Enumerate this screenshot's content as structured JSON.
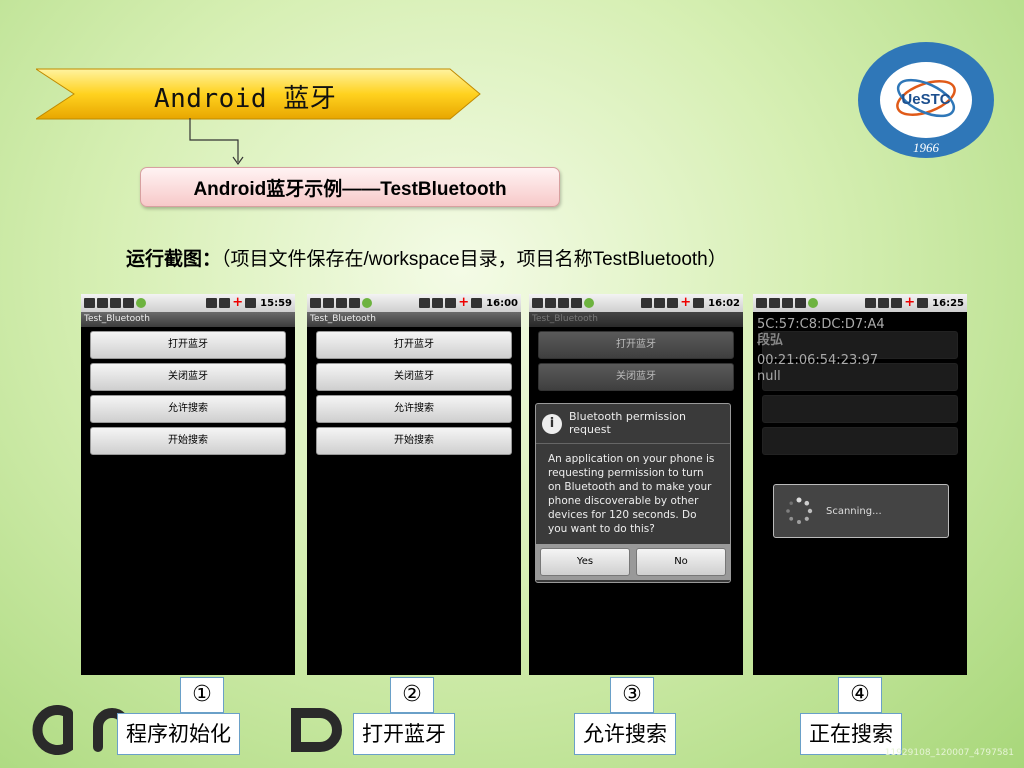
{
  "slide": {
    "title": "Android 蓝牙",
    "subtitle": "Android蓝牙示例——TestBluetooth",
    "caption_bold": "运行截图：",
    "caption_rest": "（项目文件保存在/workspace目录，项目名称TestBluetooth）",
    "watermark": "11929108_120007_4797581"
  },
  "logo": {
    "center": "UeSTC",
    "year": "1966"
  },
  "phones": [
    {
      "time": "15:59",
      "app_title": "Test_Bluetooth",
      "buttons": [
        "打开蓝牙",
        "关闭蓝牙",
        "允许搜索",
        "开始搜索"
      ],
      "step_number": "①",
      "step_label": "程序初始化"
    },
    {
      "time": "16:00",
      "app_title": "Test_Bluetooth",
      "buttons": [
        "打开蓝牙",
        "关闭蓝牙",
        "允许搜索",
        "开始搜索"
      ],
      "step_number": "②",
      "step_label": "打开蓝牙"
    },
    {
      "time": "16:02",
      "app_title": "Test_Bluetooth",
      "buttons": [
        "打开蓝牙",
        "关闭蓝牙"
      ],
      "dialog": {
        "title": "Bluetooth permission request",
        "body": "An application on your phone is requesting permission to turn on Bluetooth and to make your phone discoverable by other devices for 120 seconds. Do you want to do this?",
        "yes": "Yes",
        "no": "No"
      },
      "step_number": "③",
      "step_label": "允许搜索"
    },
    {
      "time": "16:25",
      "scan_lines": [
        "5C:57:C8:DC:D7:A4",
        "段弘",
        "00:21:06:54:23:97",
        "null"
      ],
      "progress_text": "Scanning...",
      "step_number": "④",
      "step_label": "正在搜索"
    }
  ]
}
